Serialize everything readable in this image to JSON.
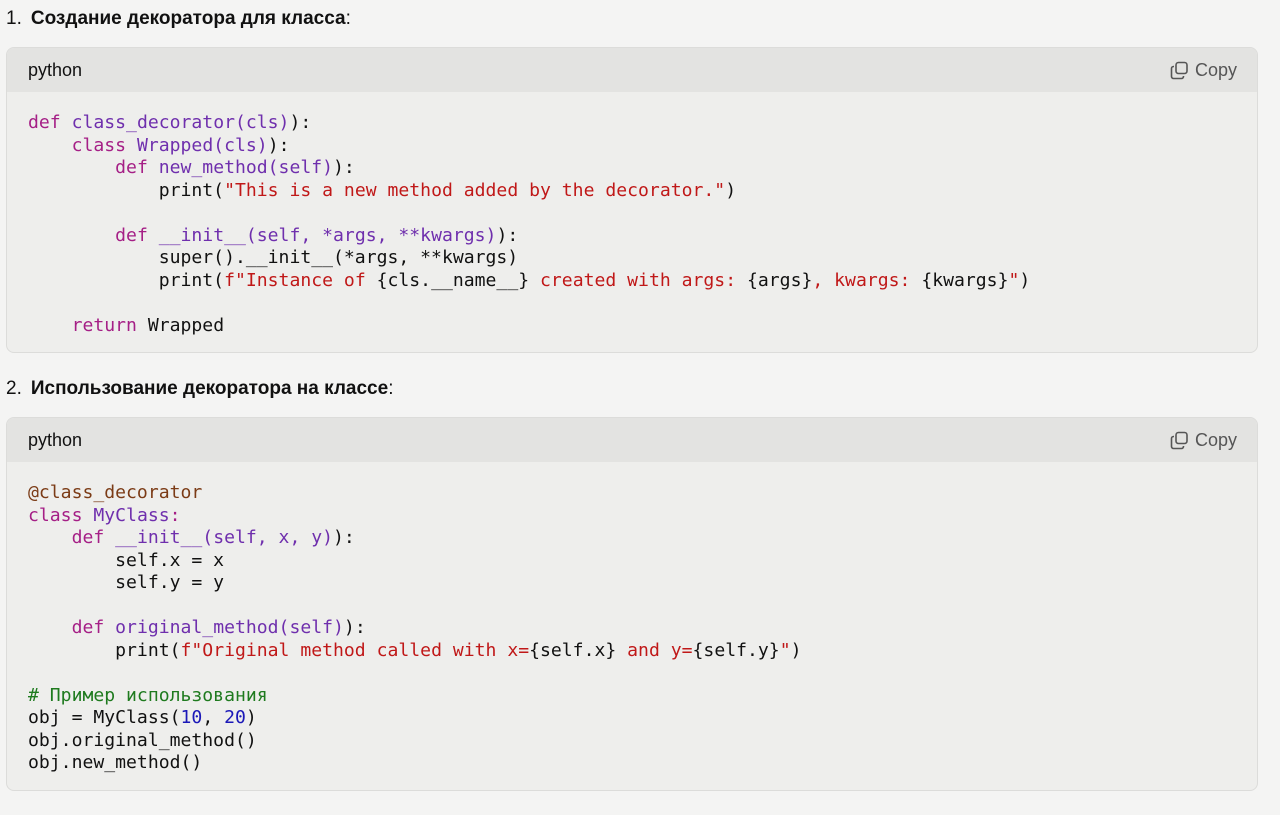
{
  "steps": [
    {
      "number": "1.",
      "title": "Создание декоратора для класса",
      "suffix": ":"
    },
    {
      "number": "2.",
      "title": "Использование декоратора на классе",
      "suffix": ":"
    }
  ],
  "code_blocks": [
    {
      "language": "python",
      "copy_label": "Copy",
      "lines": [
        [
          [
            "kw",
            "def "
          ],
          [
            "fn",
            "class_decorator(cls)"
          ],
          [
            "",
            "):"
          ]
        ],
        [
          [
            "",
            "    "
          ],
          [
            "kw",
            "class "
          ],
          [
            "fn",
            "Wrapped(cls)"
          ],
          [
            "",
            "):"
          ]
        ],
        [
          [
            "",
            "        "
          ],
          [
            "kw",
            "def "
          ],
          [
            "fn",
            "new_method(self)"
          ],
          [
            "",
            "):"
          ]
        ],
        [
          [
            "",
            "            print("
          ],
          [
            "st",
            "\"This is a new method added by the decorator.\""
          ],
          [
            "",
            ")"
          ]
        ],
        [
          [
            "",
            ""
          ]
        ],
        [
          [
            "",
            "        "
          ],
          [
            "kw",
            "def "
          ],
          [
            "fn",
            "__init__(self, *args, **kwargs)"
          ],
          [
            "",
            "):"
          ]
        ],
        [
          [
            "",
            "            super().__init__(*args, **kwargs)"
          ]
        ],
        [
          [
            "",
            "            print("
          ],
          [
            "st",
            "f\"Instance of "
          ],
          [
            "",
            "{cls.__name__}"
          ],
          [
            "st",
            " created with args: "
          ],
          [
            "",
            "{args}"
          ],
          [
            "st",
            ", kwargs: "
          ],
          [
            "",
            "{kwargs}"
          ],
          [
            "st",
            "\""
          ],
          [
            "",
            ")"
          ]
        ],
        [
          [
            "",
            ""
          ]
        ],
        [
          [
            "",
            "    "
          ],
          [
            "kw",
            "return "
          ],
          [
            "",
            "Wrapped"
          ]
        ]
      ]
    },
    {
      "language": "python",
      "copy_label": "Copy",
      "lines": [
        [
          [
            "dc",
            "@class_decorator"
          ]
        ],
        [
          [
            "kw",
            "class "
          ],
          [
            "fn",
            "MyClass"
          ],
          [
            "kw",
            ":"
          ]
        ],
        [
          [
            "",
            "    "
          ],
          [
            "kw",
            "def "
          ],
          [
            "fn",
            "__init__(self, x, y)"
          ],
          [
            "",
            "):"
          ]
        ],
        [
          [
            "",
            "        self.x = x"
          ]
        ],
        [
          [
            "",
            "        self.y = y"
          ]
        ],
        [
          [
            "",
            ""
          ]
        ],
        [
          [
            "",
            "    "
          ],
          [
            "kw",
            "def "
          ],
          [
            "fn",
            "original_method(self)"
          ],
          [
            "",
            "):"
          ]
        ],
        [
          [
            "",
            "        print("
          ],
          [
            "st",
            "f\"Original method called with x="
          ],
          [
            "",
            "{self.x}"
          ],
          [
            "st",
            " and y="
          ],
          [
            "",
            "{self.y}"
          ],
          [
            "st",
            "\""
          ],
          [
            "",
            ")"
          ]
        ],
        [
          [
            "",
            ""
          ]
        ],
        [
          [
            "cm",
            "# Пример использования"
          ]
        ],
        [
          [
            "",
            "obj = MyClass("
          ],
          [
            "nm",
            "10"
          ],
          [
            "",
            ", "
          ],
          [
            "nm",
            "20"
          ],
          [
            "",
            ")"
          ]
        ],
        [
          [
            "",
            "obj.original_method()"
          ]
        ],
        [
          [
            "",
            "obj.new_method()"
          ]
        ]
      ]
    }
  ]
}
